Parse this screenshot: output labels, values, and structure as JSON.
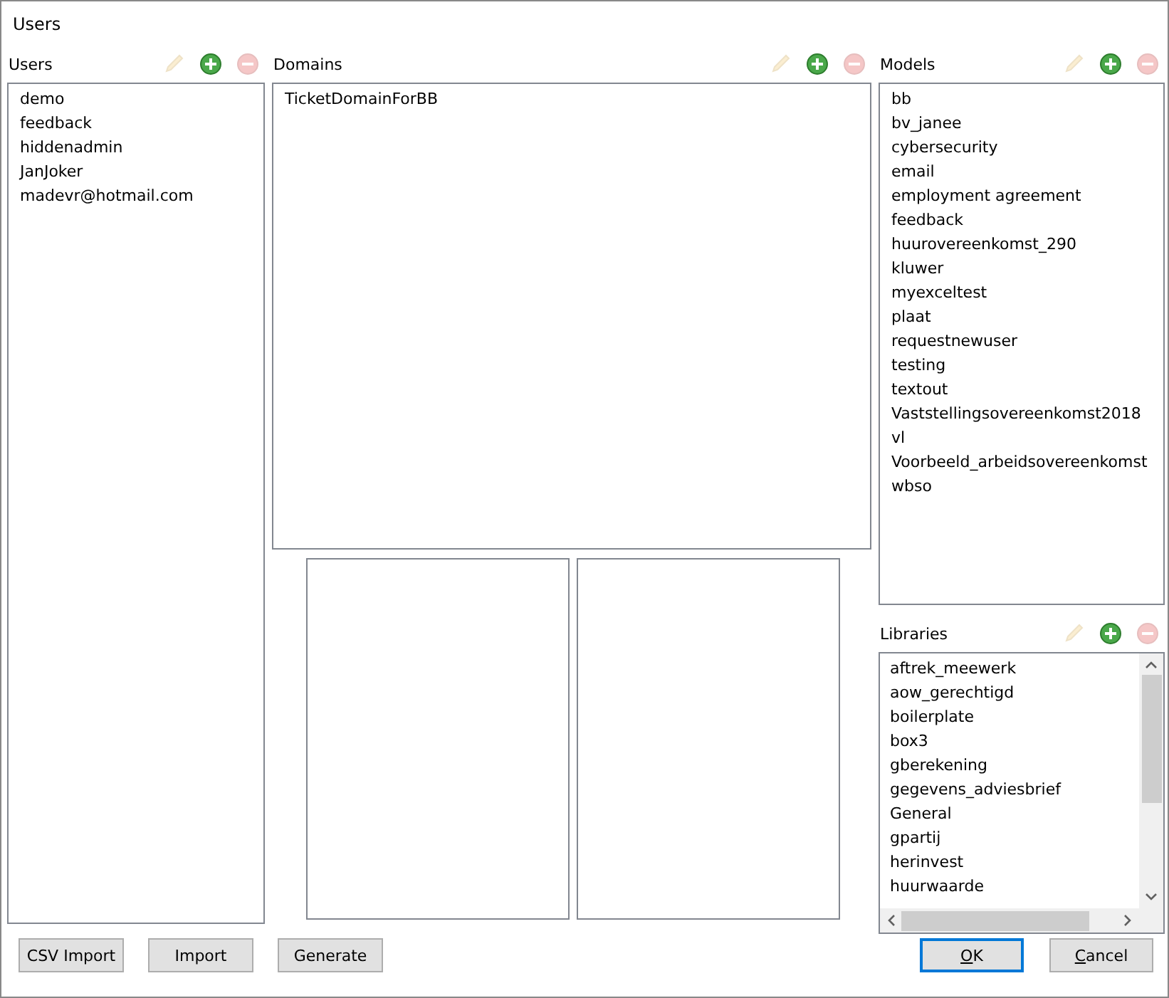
{
  "window": {
    "title": "Users"
  },
  "users": {
    "label": "Users",
    "tools": [
      {
        "kind": "edit",
        "disabled": true
      },
      {
        "kind": "add",
        "disabled": false
      },
      {
        "kind": "remove",
        "disabled": true
      }
    ],
    "items": [
      "demo",
      "feedback",
      "hiddenadmin",
      "JanJoker",
      "madevr@hotmail.com"
    ]
  },
  "domains": {
    "label": "Domains",
    "tools": [
      {
        "kind": "edit",
        "disabled": true
      },
      {
        "kind": "add",
        "disabled": false
      },
      {
        "kind": "remove",
        "disabled": true
      }
    ],
    "items": [
      "TicketDomainForBB"
    ]
  },
  "models": {
    "label": "Models",
    "tools": [
      {
        "kind": "edit",
        "disabled": true
      },
      {
        "kind": "add",
        "disabled": false
      },
      {
        "kind": "remove",
        "disabled": true
      }
    ],
    "items": [
      "bb",
      "bv_janee",
      "cybersecurity",
      "email",
      "employment agreement",
      "feedback",
      "huurovereenkomst_290",
      "kluwer",
      "myexceltest",
      "plaat",
      "requestnewuser",
      "testing",
      "textout",
      "Vaststellingsovereenkomst2018",
      "vl",
      "Voorbeeld_arbeidsovereenkomst",
      "wbso"
    ]
  },
  "libraries": {
    "label": "Libraries",
    "tools": [
      {
        "kind": "edit",
        "disabled": true
      },
      {
        "kind": "add",
        "disabled": false
      },
      {
        "kind": "remove",
        "disabled": true
      }
    ],
    "items": [
      "aftrek_meewerk",
      "aow_gerechtigd",
      "boilerplate",
      "box3",
      "gberekening",
      "gegevens_adviesbrief",
      "General",
      "gpartij",
      "herinvest",
      "huurwaarde"
    ]
  },
  "left_buttons": [
    {
      "label": "CSV Import",
      "default": false
    },
    {
      "label": "Import",
      "default": false
    },
    {
      "label": "Generate",
      "default": false
    }
  ],
  "right_buttons": [
    {
      "label": "OK",
      "default": true
    },
    {
      "label": "Cancel",
      "default": false
    }
  ]
}
